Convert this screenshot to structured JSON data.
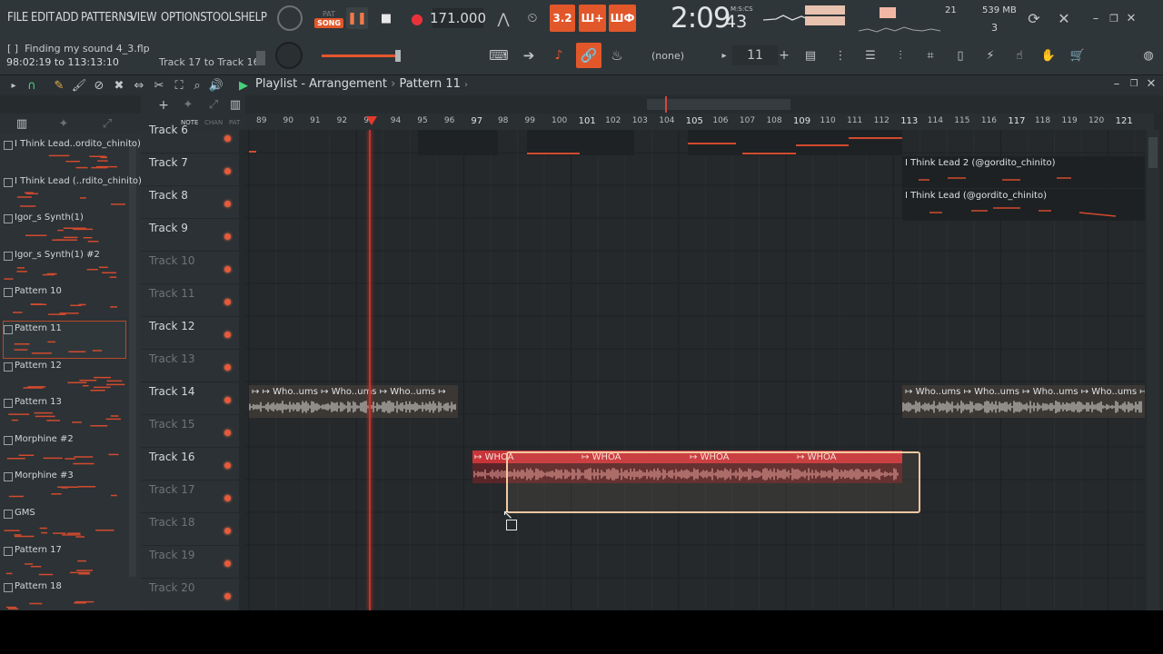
{
  "menu": [
    "FILE",
    "EDIT",
    "ADD",
    "PATTERNS",
    "VIEW",
    "OPTIONS",
    "TOOLS",
    "HELP"
  ],
  "transport": {
    "mode_top": "PAT",
    "mode_bottom": "SONG",
    "tempo": "171.000",
    "btn_a": "3.2",
    "btn_b": "Ш+",
    "btn_c": "ШФ"
  },
  "clock": {
    "main": "2:09",
    "sub": "43",
    "label": "M:S:CS"
  },
  "stats": {
    "cpu": "21",
    "mem": "539 MB",
    "voices": "3"
  },
  "hint": {
    "file": "Finding my sound 4_3.flp",
    "file_prefix": "[ ]",
    "range": "98:02:19 to 113:13:10",
    "track_range": "Track 17 to Track 16"
  },
  "toolbar2": {
    "pattern_selector": "(none)",
    "pattern_num": "11",
    "plus": "+"
  },
  "playlist": {
    "title": "Playlist - Arrangement",
    "sep": "›",
    "pattern": "Pattern 11"
  },
  "left_tabs": {
    "note": "NOTE",
    "chan": "CHAN",
    "pat": "PAT"
  },
  "patterns": [
    {
      "label": "I Think Lead..ordito_chinito)"
    },
    {
      "label": "I Think Lead (..rdito_chinito)"
    },
    {
      "label": "Igor_s Synth(1)"
    },
    {
      "label": "Igor_s Synth(1) #2"
    },
    {
      "label": "Pattern 10"
    },
    {
      "label": "Pattern 11"
    },
    {
      "label": "Pattern 12"
    },
    {
      "label": "Pattern 13"
    },
    {
      "label": "Morphine #2"
    },
    {
      "label": "Morphine #3"
    },
    {
      "label": "GMS"
    },
    {
      "label": "Pattern 17"
    },
    {
      "label": "Pattern 18"
    }
  ],
  "tracks": [
    {
      "name": "Track 6"
    },
    {
      "name": "Track 7"
    },
    {
      "name": "Track 8"
    },
    {
      "name": "Track 9"
    },
    {
      "name": "Track 10"
    },
    {
      "name": "Track 11"
    },
    {
      "name": "Track 12"
    },
    {
      "name": "Track 13"
    },
    {
      "name": "Track 14"
    },
    {
      "name": "Track 15"
    },
    {
      "name": "Track 16"
    },
    {
      "name": "Track 17"
    },
    {
      "name": "Track 18"
    },
    {
      "name": "Track 19"
    },
    {
      "name": "Track 20"
    }
  ],
  "ruler": [
    "89",
    "90",
    "91",
    "92",
    "93",
    "94",
    "95",
    "96",
    "97",
    "98",
    "99",
    "100",
    "101",
    "102",
    "103",
    "104",
    "105",
    "106",
    "107",
    "108",
    "109",
    "110",
    "111",
    "112",
    "113",
    "114",
    "115",
    "116",
    "117",
    "118",
    "119",
    "120",
    "121"
  ],
  "clips": {
    "lead2": "I Think Lead 2 (@gordito_chinito)",
    "lead": "I Think Lead (@gordito_chinito)",
    "whoums": "Who..ums",
    "whoa": "WHOA"
  },
  "colors": {
    "accent": "#e2572a",
    "clip_red": "#c7353a",
    "clip_tan": "#6a5a4a",
    "selection": "#f3c8a0"
  }
}
